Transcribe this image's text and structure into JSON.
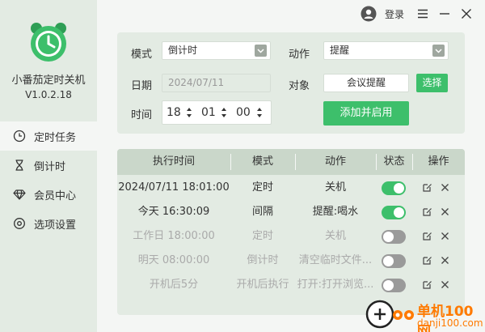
{
  "app": {
    "name": "小番茄定时关机",
    "version": "V1.0.2.18"
  },
  "sidebar": {
    "items": [
      {
        "label": "定时任务",
        "icon": "clock-icon",
        "active": true
      },
      {
        "label": "倒计时",
        "icon": "hourglass-icon",
        "active": false
      },
      {
        "label": "会员中心",
        "icon": "diamond-icon",
        "active": false
      },
      {
        "label": "选项设置",
        "icon": "gear-icon",
        "active": false
      }
    ]
  },
  "titlebar": {
    "login_label": "登录"
  },
  "form": {
    "mode_label": "模式",
    "mode_value": "倒计时",
    "action_label": "动作",
    "action_value": "提醒",
    "date_label": "日期",
    "date_value": "2024/07/11",
    "target_label": "对象",
    "target_value": "会议提醒",
    "choose_button": "选择",
    "time_label": "时间",
    "time_hour": "18",
    "time_minute": "01",
    "time_second": "00",
    "add_button": "添加并启用"
  },
  "table": {
    "headers": [
      "执行时间",
      "模式",
      "动作",
      "状态",
      "操作"
    ],
    "rows": [
      {
        "time": "2024/07/11 18:01:00",
        "mode": "定时",
        "action": "关机",
        "enabled": true
      },
      {
        "time": "今天 16:30:09",
        "mode": "间隔",
        "action": "提醒:喝水",
        "enabled": true
      },
      {
        "time": "工作日 18:00:00",
        "mode": "定时",
        "action": "关机",
        "enabled": false
      },
      {
        "time": "明天 08:00:00",
        "mode": "倒计时",
        "action": "清空临时文件...",
        "enabled": false
      },
      {
        "time": "开机后5分",
        "mode": "开机后执行",
        "action": "打开:打开浏览...",
        "enabled": false
      }
    ]
  },
  "watermark": {
    "title": "单机100网",
    "url": "danji100.com"
  },
  "colors": {
    "accent": "#3dbf6b",
    "sidebar_bg": "#e3ebe3",
    "header_bg": "#cad7ca",
    "watermark": "#ff7a00"
  }
}
